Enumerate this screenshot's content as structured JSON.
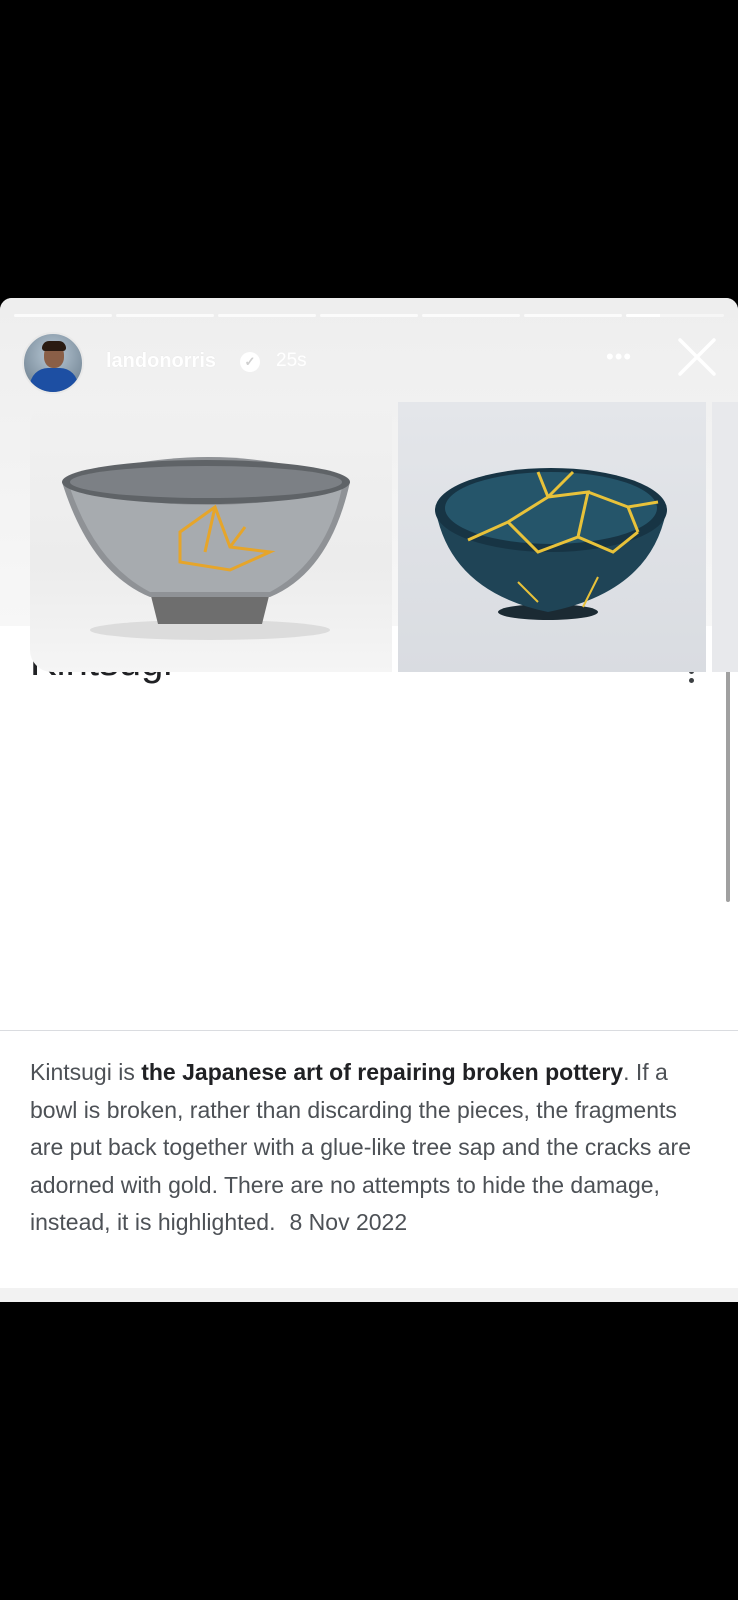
{
  "story": {
    "username": "landonorris",
    "time_ago": "25s",
    "progress_segments": 7,
    "active_segment_index": 6,
    "active_segment_progress": 0.35
  },
  "card": {
    "title": "Kintsugi",
    "images": [
      {
        "alt": "grey bowl with gold cracks"
      },
      {
        "alt": "blue bowl with gold cracks"
      }
    ],
    "description": {
      "part1": "Kintsugi is ",
      "bold": "the Japanese art of repairing broken pottery",
      "part2": ". If a bowl is broken, rather than discarding the pieces, the fragments are put back together with a glue-like tree sap and the cracks are adorned with gold. There are no attempts to hide the damage, instead, it is highlighted.",
      "date": "8 Nov 2022"
    }
  },
  "colors": {
    "background": "#000000",
    "card": "#ffffff",
    "gold": "#e0b030"
  },
  "icons": [
    "verified-icon",
    "more-icon",
    "close-icon",
    "kebab-menu-icon"
  ]
}
